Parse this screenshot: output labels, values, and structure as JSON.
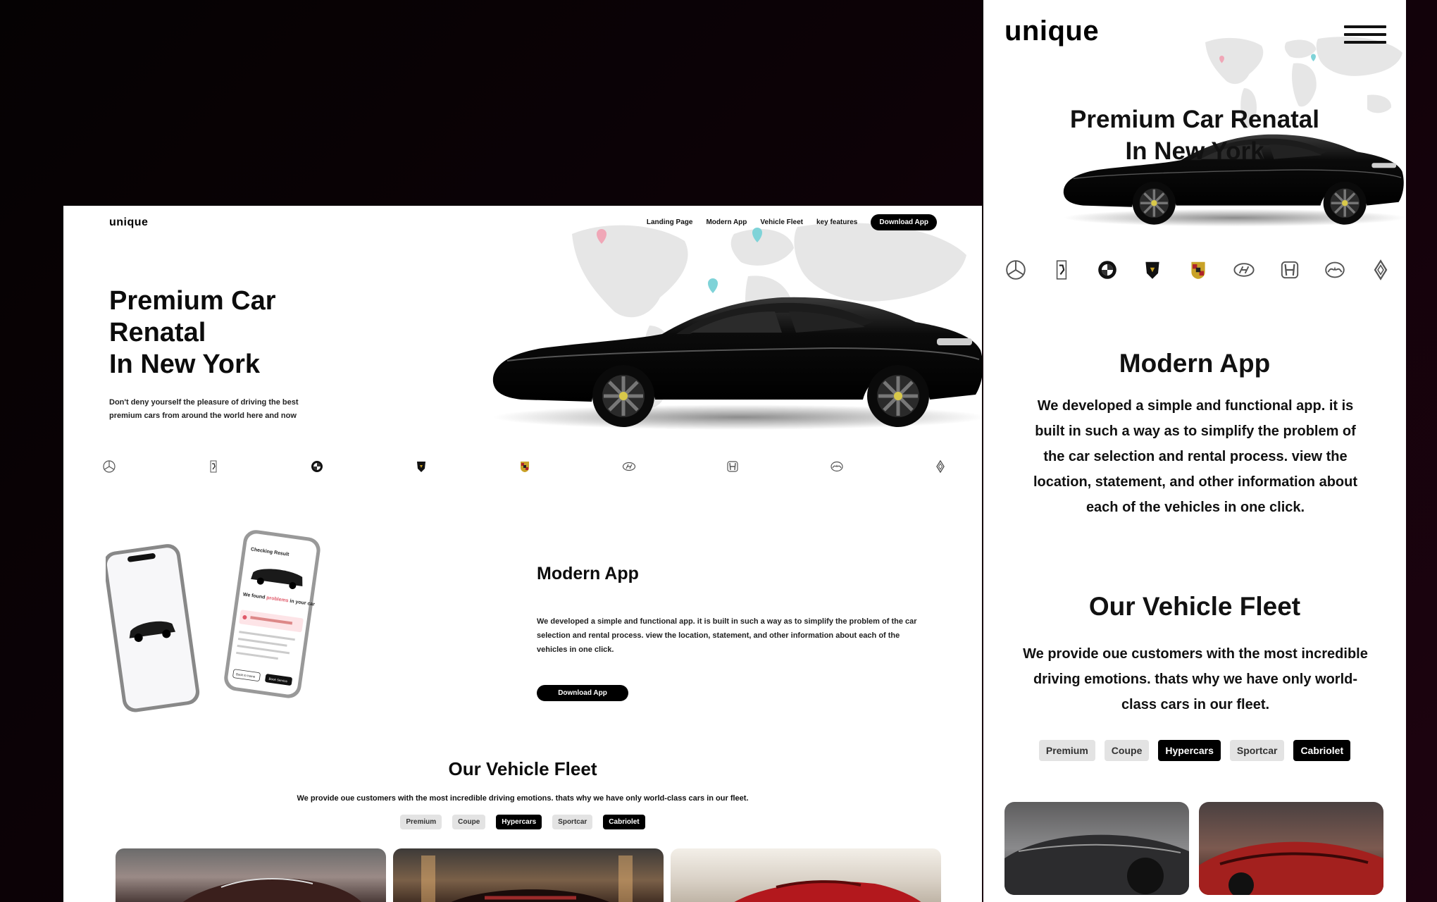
{
  "colors": {
    "accent": "#000000",
    "chip_bg": "#e3e3e3",
    "pin_pink": "#f0a7b7",
    "pin_teal": "#7fd3d8"
  },
  "desktop": {
    "logo": "unique",
    "nav": [
      "Landing Page",
      "Modern App",
      "Vehicle Fleet",
      "key features"
    ],
    "nav_button": "Download App",
    "hero": {
      "title": [
        "Premium Car",
        "Renatal",
        "In New York"
      ],
      "subtitle": "Don't deny yourself the pleasure of driving the best premium cars from around the world here and now"
    },
    "brands": [
      "mercedes-icon",
      "ferrari-icon",
      "bmw-icon",
      "lamborghini-icon",
      "porsche-icon",
      "hyundai-icon",
      "honda-icon",
      "mazda-icon",
      "renault-icon"
    ],
    "app": {
      "title": "Modern App",
      "description": "We developed a simple and functional app. it is built in such a way as to simplify the problem of the car selection and rental process. view the location, statement, and other information about each of the vehicles in one click.",
      "button": "Download App"
    },
    "fleet": {
      "title": "Our Vehicle Fleet",
      "description": "We provide oue customers with the most incredible driving emotions. thats why we have only world-class cars in our fleet.",
      "filters": [
        {
          "label": "Premium",
          "active": false
        },
        {
          "label": "Coupe",
          "active": false
        },
        {
          "label": "Hypercars",
          "active": true
        },
        {
          "label": "Sportcar",
          "active": false
        },
        {
          "label": "Cabriolet",
          "active": true
        }
      ]
    },
    "phone": {
      "header": "Checking Result",
      "found_prefix": "We found ",
      "found_highlight": "problems",
      "found_suffix": " in your car",
      "btn_left": "Back to home",
      "btn_right": "Book Service"
    }
  },
  "mobile": {
    "logo": "unique",
    "hero": {
      "title_line1": "Premium Car Renatal",
      "title_line2": "In New York"
    },
    "app": {
      "title": "Modern App",
      "description": "We developed a simple and functional app. it is built in such a way as to simplify the problem of the car selection and rental process. view the location, statement, and other information about each of the vehicles in one click."
    },
    "fleet": {
      "title": "Our Vehicle Fleet",
      "description": "We provide oue customers with the most incredible driving emotions. thats why we have only world-class cars in our fleet.",
      "filters": [
        {
          "label": "Premium",
          "active": false
        },
        {
          "label": "Coupe",
          "active": false
        },
        {
          "label": "Hypercars",
          "active": true
        },
        {
          "label": "Sportcar",
          "active": false
        },
        {
          "label": "Cabriolet",
          "active": true
        }
      ]
    }
  }
}
